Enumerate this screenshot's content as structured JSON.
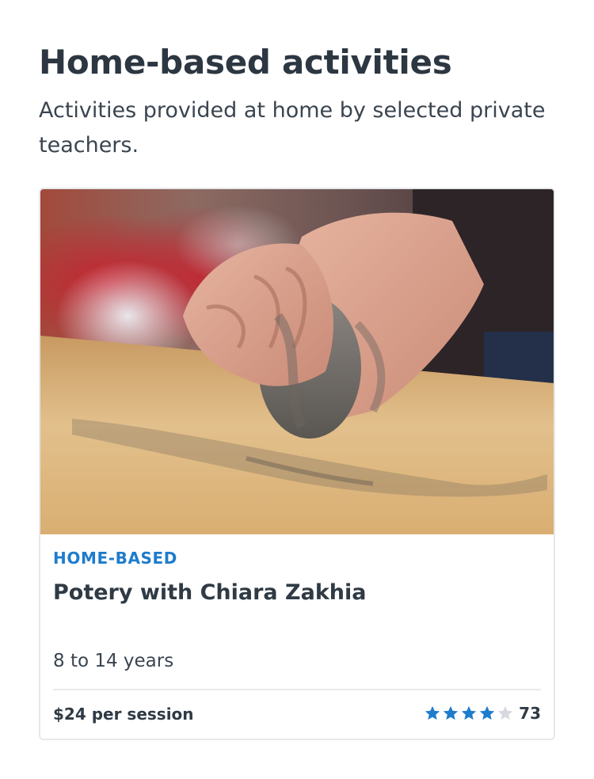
{
  "section": {
    "title": "Home-based activities",
    "subtitle": "Activities provided at home by selected private teachers."
  },
  "card": {
    "image_label": "hands kneading clay on wooden table",
    "category": "HOME-BASED",
    "title": "Potery with Chiara Zakhia",
    "age_range": "8 to 14 years",
    "price": "$24 per session",
    "rating": {
      "stars_filled": 4,
      "stars_total": 5,
      "review_count": "73"
    },
    "colors": {
      "category": "#1e7ccc",
      "star_filled": "#1e7ccc",
      "star_empty": "#d6dade"
    }
  }
}
